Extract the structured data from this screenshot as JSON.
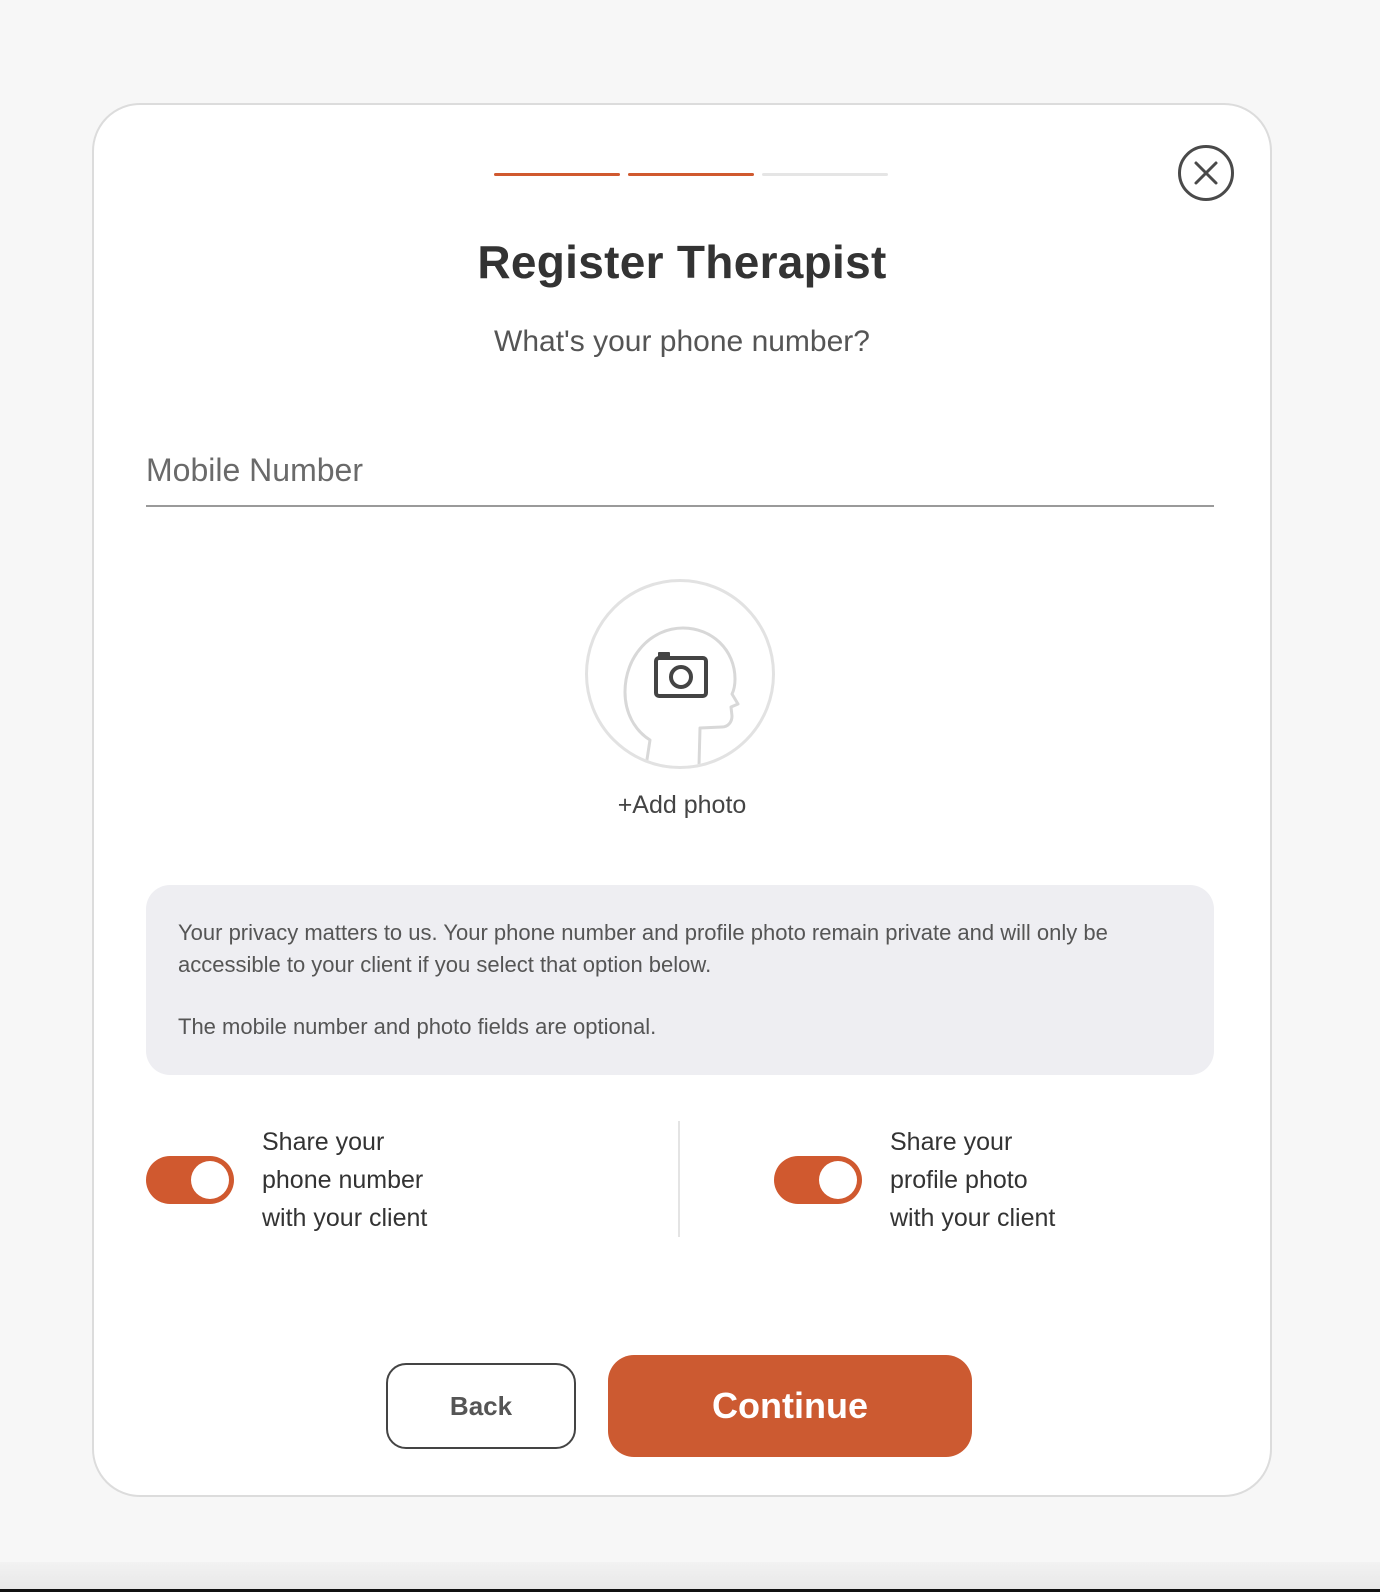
{
  "progress": {
    "total_steps": 3,
    "completed_steps": 2
  },
  "header": {
    "title": "Register Therapist",
    "subtitle": "What's your phone number?"
  },
  "form": {
    "mobile_placeholder": "Mobile Number",
    "mobile_value": ""
  },
  "photo": {
    "add_label": "+Add photo"
  },
  "notice": {
    "paragraph1": "Your privacy matters to us. Your phone number and profile photo remain private and will only be accessible to your client if you select that option below.",
    "paragraph2": "The mobile number and photo fields are optional."
  },
  "toggles": [
    {
      "line1": "Share your",
      "line2": "phone number",
      "line3": "with your client",
      "on": true
    },
    {
      "line1": "Share your",
      "line2": "profile photo",
      "line3": "with your client",
      "on": true
    }
  ],
  "buttons": {
    "back": "Back",
    "continue": "Continue"
  },
  "colors": {
    "accent": "#cc5a31",
    "notice_bg": "#eeeef2"
  }
}
